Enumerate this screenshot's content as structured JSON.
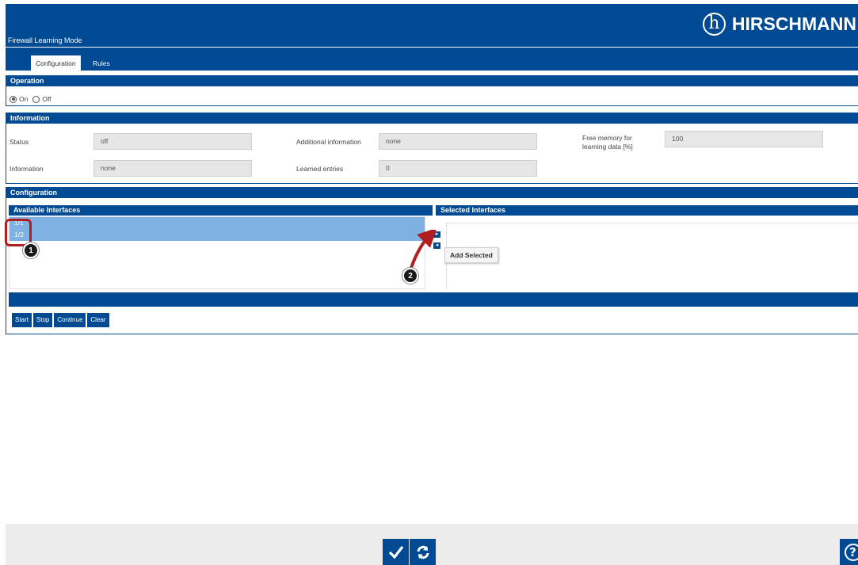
{
  "header": {
    "title": "Firewall Learning Mode",
    "brand": "HIRSCHMANN",
    "logo_glyph": "h"
  },
  "tabs": [
    {
      "label": "Configuration",
      "active": true
    },
    {
      "label": "Rules",
      "active": false
    }
  ],
  "operation": {
    "heading": "Operation",
    "options": [
      {
        "label": "On",
        "checked": true
      },
      {
        "label": "Off",
        "checked": false
      }
    ]
  },
  "information": {
    "heading": "Information",
    "fields": [
      {
        "label": "Status",
        "value": "off"
      },
      {
        "label": "Additional information",
        "value": "none"
      },
      {
        "label": "Free memory for learning data [%]",
        "value": "100"
      },
      {
        "label": "Information",
        "value": "none"
      },
      {
        "label": "Learned entries",
        "value": "0"
      }
    ]
  },
  "configuration": {
    "heading": "Configuration",
    "available_heading": "Available Interfaces",
    "selected_heading": "Selected Interfaces",
    "available_items": [
      "1/1",
      "1/2"
    ],
    "selected_items": [],
    "tooltip": "Add Selected",
    "buttons": [
      "Start",
      "Stop",
      "Continue",
      "Clear"
    ]
  },
  "annotations": {
    "badge1": "1",
    "badge2": "2",
    "highlight_color": "#b01e1e"
  },
  "footer": {
    "apply_icon": "checkmark-icon",
    "reload_icon": "reload-icon",
    "help_icon": "help-icon",
    "help_glyph": "?"
  },
  "colors": {
    "primary": "#004a93",
    "list_selected": "#7fb1e2",
    "field_bg": "#e6e6e6",
    "footer_bg": "#ececec"
  }
}
